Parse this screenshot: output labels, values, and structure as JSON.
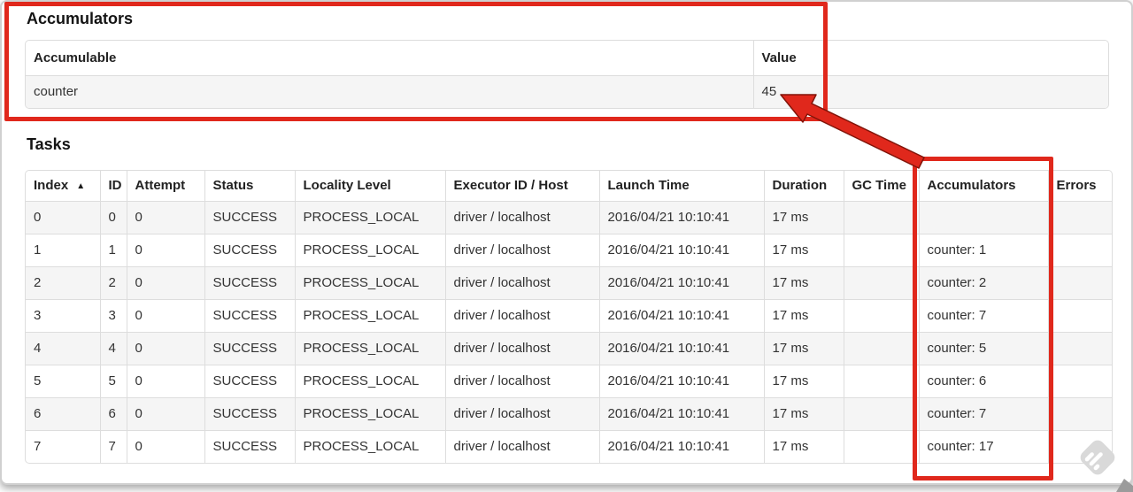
{
  "colors": {
    "annotation_red": "#e0281c",
    "table_border": "#dddddd",
    "row_stripe": "#f5f5f5",
    "text": "#333333"
  },
  "accumulators_section": {
    "title": "Accumulators",
    "columns": [
      {
        "key": "accumulable",
        "label": "Accumulable"
      },
      {
        "key": "value",
        "label": "Value"
      }
    ],
    "rows": [
      {
        "accumulable": "counter",
        "value": "45"
      }
    ]
  },
  "tasks_section": {
    "title": "Tasks",
    "sort_indicator": "▲",
    "sorted_column": "Index",
    "columns": [
      {
        "key": "index",
        "label": "Index",
        "sorted": true
      },
      {
        "key": "id",
        "label": "ID"
      },
      {
        "key": "attempt",
        "label": "Attempt"
      },
      {
        "key": "status",
        "label": "Status"
      },
      {
        "key": "locality_level",
        "label": "Locality Level"
      },
      {
        "key": "executor_id_host",
        "label": "Executor ID / Host"
      },
      {
        "key": "launch_time",
        "label": "Launch Time"
      },
      {
        "key": "duration",
        "label": "Duration"
      },
      {
        "key": "gc_time",
        "label": "GC Time"
      },
      {
        "key": "accumulators",
        "label": "Accumulators"
      },
      {
        "key": "errors",
        "label": "Errors"
      }
    ],
    "rows": [
      {
        "index": "0",
        "id": "0",
        "attempt": "0",
        "status": "SUCCESS",
        "locality_level": "PROCESS_LOCAL",
        "executor_id_host": "driver / localhost",
        "launch_time": "2016/04/21 10:10:41",
        "duration": "17 ms",
        "gc_time": "",
        "accumulators": "",
        "errors": ""
      },
      {
        "index": "1",
        "id": "1",
        "attempt": "0",
        "status": "SUCCESS",
        "locality_level": "PROCESS_LOCAL",
        "executor_id_host": "driver / localhost",
        "launch_time": "2016/04/21 10:10:41",
        "duration": "17 ms",
        "gc_time": "",
        "accumulators": "counter: 1",
        "errors": ""
      },
      {
        "index": "2",
        "id": "2",
        "attempt": "0",
        "status": "SUCCESS",
        "locality_level": "PROCESS_LOCAL",
        "executor_id_host": "driver / localhost",
        "launch_time": "2016/04/21 10:10:41",
        "duration": "17 ms",
        "gc_time": "",
        "accumulators": "counter: 2",
        "errors": ""
      },
      {
        "index": "3",
        "id": "3",
        "attempt": "0",
        "status": "SUCCESS",
        "locality_level": "PROCESS_LOCAL",
        "executor_id_host": "driver / localhost",
        "launch_time": "2016/04/21 10:10:41",
        "duration": "17 ms",
        "gc_time": "",
        "accumulators": "counter: 7",
        "errors": ""
      },
      {
        "index": "4",
        "id": "4",
        "attempt": "0",
        "status": "SUCCESS",
        "locality_level": "PROCESS_LOCAL",
        "executor_id_host": "driver / localhost",
        "launch_time": "2016/04/21 10:10:41",
        "duration": "17 ms",
        "gc_time": "",
        "accumulators": "counter: 5",
        "errors": ""
      },
      {
        "index": "5",
        "id": "5",
        "attempt": "0",
        "status": "SUCCESS",
        "locality_level": "PROCESS_LOCAL",
        "executor_id_host": "driver / localhost",
        "launch_time": "2016/04/21 10:10:41",
        "duration": "17 ms",
        "gc_time": "",
        "accumulators": "counter: 6",
        "errors": ""
      },
      {
        "index": "6",
        "id": "6",
        "attempt": "0",
        "status": "SUCCESS",
        "locality_level": "PROCESS_LOCAL",
        "executor_id_host": "driver / localhost",
        "launch_time": "2016/04/21 10:10:41",
        "duration": "17 ms",
        "gc_time": "",
        "accumulators": "counter: 7",
        "errors": ""
      },
      {
        "index": "7",
        "id": "7",
        "attempt": "0",
        "status": "SUCCESS",
        "locality_level": "PROCESS_LOCAL",
        "executor_id_host": "driver / localhost",
        "launch_time": "2016/04/21 10:10:41",
        "duration": "17 ms",
        "gc_time": "",
        "accumulators": "counter: 17",
        "errors": ""
      }
    ]
  },
  "annotations": {
    "color": "#e0281c",
    "boxes": [
      {
        "target": "accumulators-section"
      },
      {
        "target": "tasks-accumulators-column"
      }
    ],
    "arrow": {
      "from": "tasks-accumulators-column",
      "points_to": "accumulator-value-45"
    }
  },
  "icons": {
    "sort": "sort-ascending-icon",
    "watermark": "striped-diamond-watermark-icon",
    "corner": "pencil-cursor-icon"
  }
}
